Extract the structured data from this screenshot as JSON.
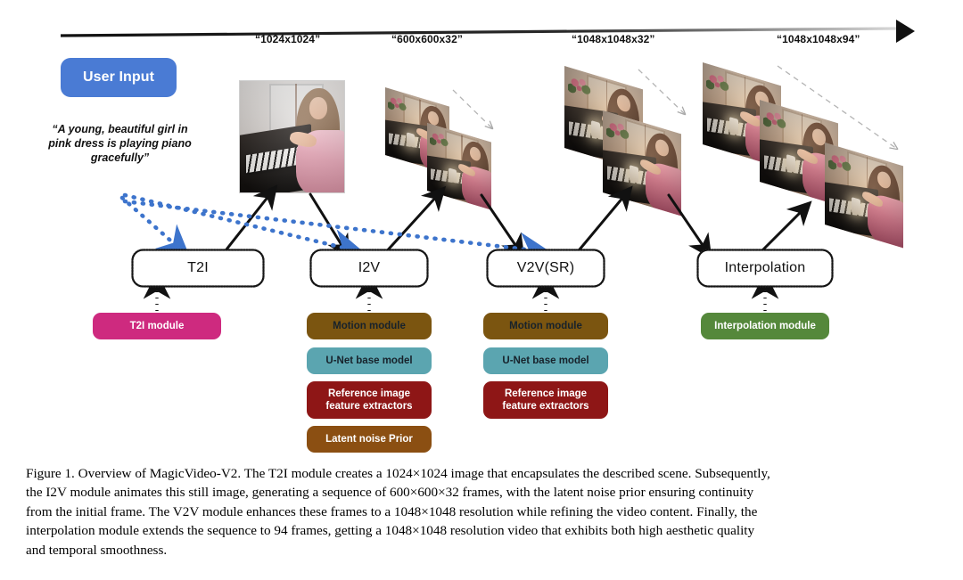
{
  "figure": {
    "timeline_arrow": "rightward-timeline-arrow",
    "user_input": {
      "button_label": "User Input",
      "button_color": "#4a7bd4",
      "prompt_text": "“A young, beautiful girl in pink dress is playing piano gracefully”"
    },
    "resolution_labels": [
      {
        "id": "t2i-output",
        "text": "“1024x1024”"
      },
      {
        "id": "i2v-output",
        "text": "“600x600x32”"
      },
      {
        "id": "v2v-output",
        "text": "“1048x1048x32”"
      },
      {
        "id": "interpolation-output",
        "text": "“1048x1048x94”"
      }
    ],
    "stages": [
      {
        "id": "t2i",
        "label": "T2I",
        "modules": [
          {
            "label": "T2I module",
            "color": "#ce2a7f",
            "text_color": "#ffffff"
          }
        ]
      },
      {
        "id": "i2v",
        "label": "I2V",
        "modules": [
          {
            "label": "Motion module",
            "color": "#7b5510",
            "text_color": "#17222b"
          },
          {
            "label": "U-Net base model",
            "color": "#5ba5b0",
            "text_color": "#17222b"
          },
          {
            "label": "Reference image feature extractors",
            "color": "#8e1616",
            "text_color": "#ffffff"
          },
          {
            "label": "Latent noise Prior",
            "color": "#8b4f12",
            "text_color": "#ffffff"
          }
        ]
      },
      {
        "id": "v2v-sr",
        "label": "V2V(SR)",
        "modules": [
          {
            "label": "Motion module",
            "color": "#7b5510",
            "text_color": "#17222b"
          },
          {
            "label": "U-Net base model",
            "color": "#5ba5b0",
            "text_color": "#17222b"
          },
          {
            "label": "Reference image feature extractors",
            "color": "#8e1616",
            "text_color": "#ffffff"
          }
        ]
      },
      {
        "id": "interpolation",
        "label": "Interpolation",
        "modules": [
          {
            "label": "Interpolation module",
            "color": "#55883b",
            "text_color": "#ffffff"
          }
        ]
      }
    ],
    "flow_arrows": {
      "prompt_arrow_color": "#3d74cc",
      "prompt_arrow_targets": [
        "T2I",
        "I2V",
        "V2V(SR)"
      ],
      "data_arrow_color": "#111111"
    }
  },
  "caption": {
    "lines": [
      "Figure 1. Overview of MagicVideo-V2. The T2I module creates a 1024×1024 image that encapsulates the described scene. Subsequently,",
      "the I2V module animates this still image, generating a sequence of 600×600×32 frames, with the latent noise prior ensuring continuity",
      "from the initial frame. The V2V module enhances these frames to a 1048×1048 resolution while refining the video content. Finally, the",
      "interpolation module extends the sequence to 94 frames, getting a 1048×1048 resolution video that exhibits both high aesthetic quality",
      "and temporal smoothness."
    ]
  }
}
